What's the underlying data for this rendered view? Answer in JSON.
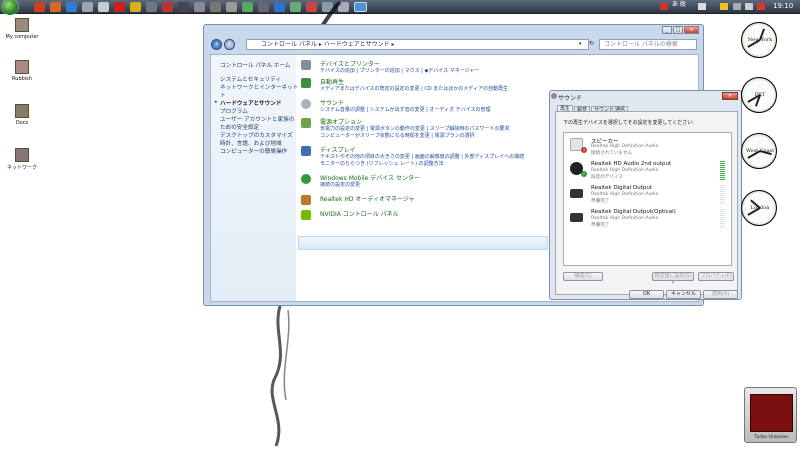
{
  "taskbar": {
    "clock": "19:10",
    "tray_ime": "あ 般"
  },
  "desktop": {
    "icons": [
      {
        "label": "My computer"
      },
      {
        "label": "Rubbish"
      },
      {
        "label": "Docs"
      },
      {
        "label": "ネットワーク"
      }
    ]
  },
  "explorer": {
    "address": "コントロール パネル ▸ ハードウェアとサウンド ▸",
    "search_placeholder": "コントロール パネルの検索",
    "left_pane": [
      {
        "label": "コントロール パネル ホーム"
      },
      {
        "label": "システムとセキュリティ"
      },
      {
        "label": "ネットワークとインターネット"
      },
      {
        "label": "ト"
      },
      {
        "label": "ハードウェアとサウンド"
      },
      {
        "label": "プログラム"
      },
      {
        "label": "ユーザー アカウントと家族の"
      },
      {
        "label": "ための安全設定"
      },
      {
        "label": "デスクトップのカスタマイズ"
      },
      {
        "label": "時計、言語、および地域"
      },
      {
        "label": "コンピューターの簡単操作"
      }
    ],
    "categories": [
      {
        "title": "デバイスとプリンター",
        "links": [
          "デバイスの追加 | プリンターの追加 | マウス | ◆デバイス マネージャー"
        ]
      },
      {
        "title": "自動再生",
        "links": [
          "メディアまたはデバイスの既定の設定の変更 | CD またはほかのメディアの自動再生"
        ]
      },
      {
        "title": "サウンド",
        "links": [
          "システム音量の調整 | システムが出す音の変更 | オーディオ デバイスの管理"
        ]
      },
      {
        "title": "電源オプション",
        "links": [
          "省電力の設定の変更 | 電源ボタンの動作の変更 | スリープ解除時のパスワードの要求",
          "コンピューターがスリープ状態になる時間を変更 | 電源プランの選択"
        ]
      },
      {
        "title": "ディスプレイ",
        "links": [
          "テキストやその他の項目の大きさの変更 | 画面の解像度の調整 | 外部ディスプレイへの接続",
          "モニターのちらつき (リフレッシュ レート) の調整方法"
        ]
      },
      {
        "title": "Windows Mobile デバイス センター",
        "links": [
          "接続の設定の変更"
        ]
      },
      {
        "title": "Realtek HD オーディオマネージャ",
        "links": []
      },
      {
        "title": "NVIDIA コントロール パネル",
        "links": []
      }
    ]
  },
  "sound": {
    "title": "サウンド",
    "close": "✕",
    "tabs": [
      "再生",
      "録音",
      "サウンド",
      "通信"
    ],
    "instruction": "下の再生デバイスを選択してその設定を変更してください:",
    "devices": [
      {
        "name": "スピーカー",
        "driver": "Realtek High Definition Audio",
        "status": "接続されていません"
      },
      {
        "name": "Realtek HD Audio 2nd output",
        "driver": "Realtek High Definition Audio",
        "status": "既定のデバイス"
      },
      {
        "name": "Realtek Digital Output",
        "driver": "Realtek High Definition Audio",
        "status": "準備完了"
      },
      {
        "name": "Realtek Digital Output(Optical)",
        "driver": "Realtek High Definition Audio",
        "status": "準備完了"
      }
    ],
    "configure": "構成(C)",
    "set_default": "既定値に設定(S) ▾",
    "properties": "プロパティ(P)",
    "ok": "OK",
    "cancel": "キャンセル",
    "apply": "適用(A)"
  },
  "clocks": [
    {
      "label": "New York"
    },
    {
      "label": "PRT"
    },
    {
      "label": "West Coast"
    },
    {
      "label": "London"
    }
  ],
  "turbo": {
    "label": "Turbo Unlocker"
  }
}
